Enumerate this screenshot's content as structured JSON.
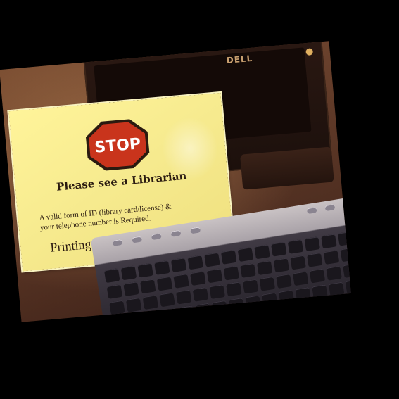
{
  "photo": {
    "sign": {
      "stop_text": "STOP",
      "heading": "Please see a Librarian",
      "body_line1": "A valid form of ID (library card/license) &",
      "body_line2": "your  telephone number is Required.",
      "price_text": "Printing is $.15 per page"
    },
    "monitor": {
      "brand": "DELL"
    },
    "colors": {
      "sign_paper": "#f6ea8e",
      "stop_red": "#c9341c",
      "background": "#000000"
    }
  }
}
